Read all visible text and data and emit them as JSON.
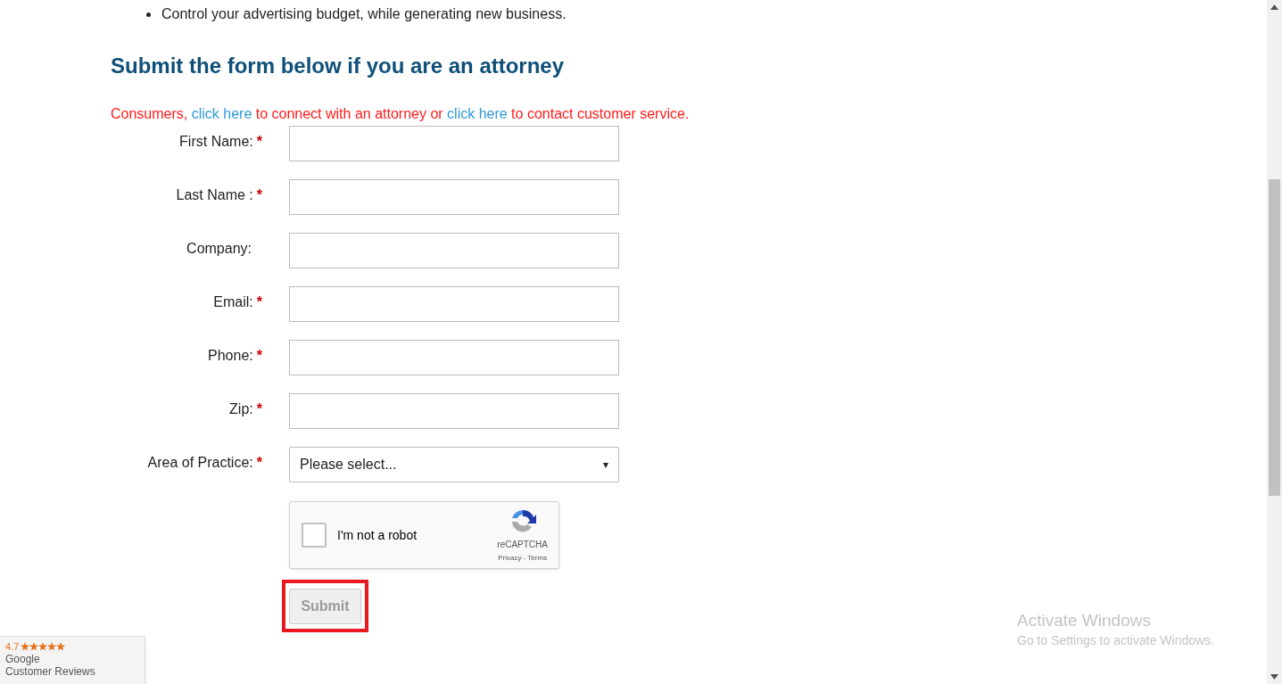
{
  "bullets": [
    "Control your advertising budget, while generating new business."
  ],
  "heading": "Submit the form below if you are an attorney",
  "notice": [
    {
      "kind": "text",
      "text": "Consumers, "
    },
    {
      "kind": "link",
      "text": "click here"
    },
    {
      "kind": "text",
      "text": " to connect with an attorney or "
    },
    {
      "kind": "link",
      "text": "click here"
    },
    {
      "kind": "text",
      "text": " to contact customer service."
    }
  ],
  "fields": [
    {
      "label": "First Name:",
      "required": true,
      "mark": "*",
      "kind": "text"
    },
    {
      "label": "Last Name :",
      "required": true,
      "mark": "*",
      "kind": "text"
    },
    {
      "label": "Company:",
      "required": false,
      "kind": "text"
    },
    {
      "label": "Email:",
      "required": true,
      "mark": "*",
      "kind": "text"
    },
    {
      "label": "Phone:",
      "required": true,
      "mark": "*",
      "kind": "text"
    },
    {
      "label": "Zip:",
      "required": true,
      "mark": "*",
      "kind": "text"
    },
    {
      "label": "Area of Practice:",
      "required": true,
      "mark": "*",
      "kind": "select",
      "placeholder": "Please select...",
      "arrow": "▾"
    }
  ],
  "captcha": {
    "label": "I'm not a robot",
    "checked": false,
    "brand": "reCAPTCHA",
    "links": "Privacy - Terms"
  },
  "submit": {
    "label": "Submit",
    "disabled": true,
    "highlighted": true
  },
  "reviews_badge": {
    "rating": "4.7",
    "stars": 5,
    "line1": "Google",
    "line2": "Customer Reviews"
  },
  "activation_notice": {
    "title": "Activate Windows",
    "subtitle": "Go to Settings to activate Windows."
  }
}
